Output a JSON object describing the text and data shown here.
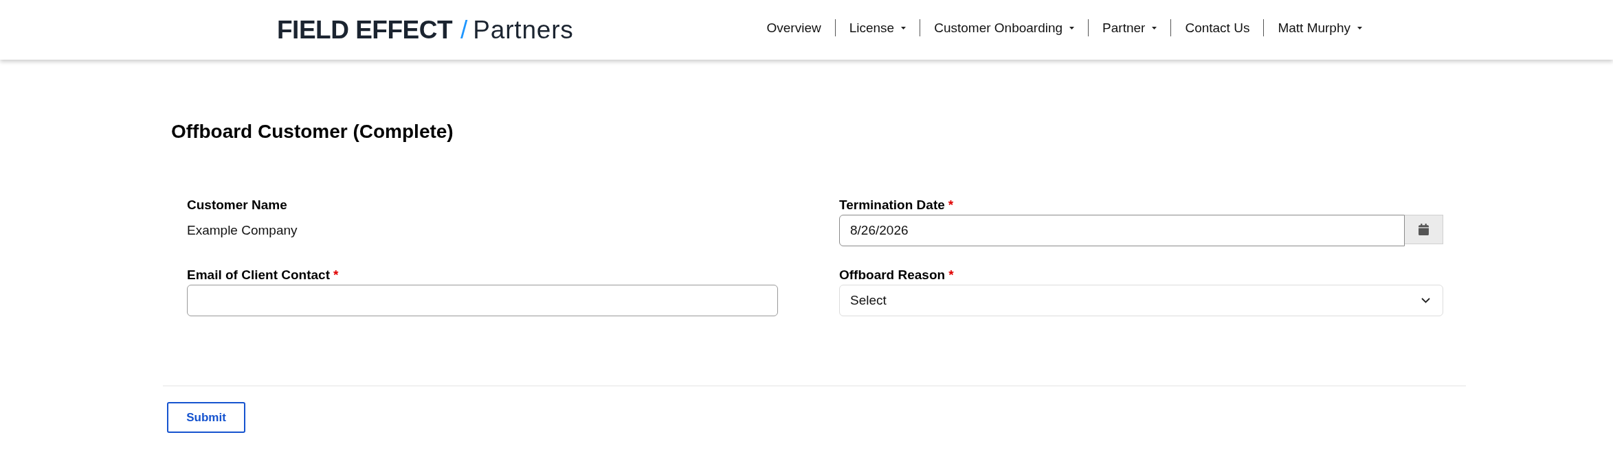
{
  "header": {
    "logo": {
      "brand": "FIELD EFFECT",
      "slash": "/",
      "product": "Partners"
    },
    "nav": [
      {
        "label": "Overview",
        "dropdown": false
      },
      {
        "label": "License",
        "dropdown": true
      },
      {
        "label": "Customer Onboarding",
        "dropdown": true
      },
      {
        "label": "Partner",
        "dropdown": true
      },
      {
        "label": "Contact Us",
        "dropdown": false
      },
      {
        "label": "Matt Murphy",
        "dropdown": true
      }
    ]
  },
  "page": {
    "title": "Offboard Customer (Complete)",
    "fields": [
      {
        "kind": "static",
        "label": "Customer Name",
        "value": "Example Company"
      },
      {
        "kind": "date",
        "label": "Termination Date",
        "required_mark": "*",
        "value": "8/26/2026"
      },
      {
        "kind": "text",
        "label": "Email of Client Contact",
        "required_mark": "*"
      },
      {
        "kind": "select",
        "label": "Offboard Reason",
        "required_mark": "*",
        "value": "Select"
      }
    ],
    "submit": {
      "label": "Submit"
    }
  }
}
